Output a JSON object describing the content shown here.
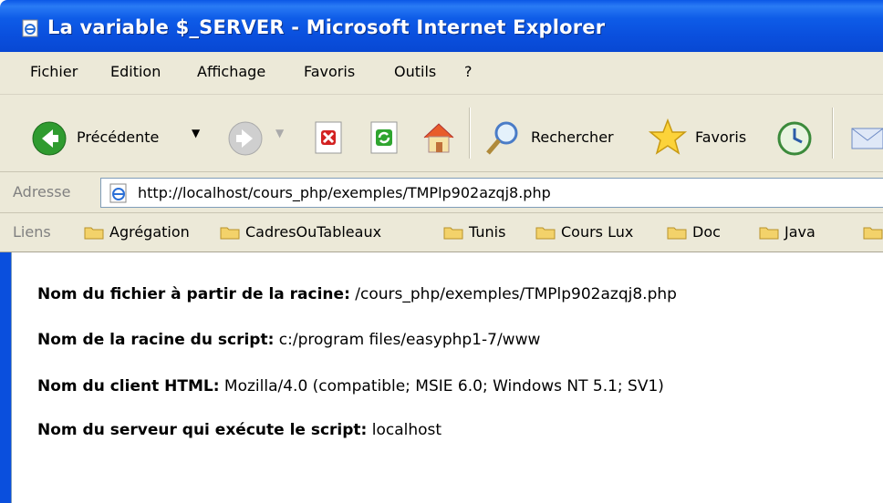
{
  "window": {
    "title": "La variable $_SERVER - Microsoft Internet Explorer"
  },
  "menu": [
    "Fichier",
    "Edition",
    "Affichage",
    "Favoris",
    "Outils",
    "?"
  ],
  "toolbar": {
    "back_label": "Précédente",
    "search_label": "Rechercher",
    "favorites_label": "Favoris"
  },
  "address": {
    "label": "Adresse",
    "url": "http://localhost/cours_php/exemples/TMPlp902azqj8.php"
  },
  "links": {
    "label": "Liens",
    "items": [
      "Agrégation",
      "CadresOuTableaux",
      "Tunis",
      "Cours Lux",
      "Doc",
      "Java"
    ]
  },
  "content": {
    "lines": [
      {
        "label": "Nom du fichier à partir de la racine:",
        "value": "/cours_php/exemples/TMPlp902azqj8.php"
      },
      {
        "label": "Nom de la racine du script:",
        "value": "c:/program files/easyphp1-7/www"
      },
      {
        "label": "Nom du client HTML:",
        "value": "Mozilla/4.0 (compatible; MSIE 6.0; Windows NT 5.1; SV1)"
      },
      {
        "label": "Nom du serveur qui exécute le script:",
        "value": "localhost"
      }
    ]
  },
  "icons": {
    "title": "ie-page-icon",
    "back": "back-arrow-icon",
    "forward": "forward-arrow-icon",
    "stop": "stop-icon",
    "refresh": "refresh-icon",
    "home": "home-icon",
    "search": "magnifier-icon",
    "favorites": "star-icon",
    "history": "history-icon",
    "mail": "mail-icon"
  },
  "colors": {
    "titlebar": "#0a4fdd",
    "chrome": "#ece9d8"
  }
}
